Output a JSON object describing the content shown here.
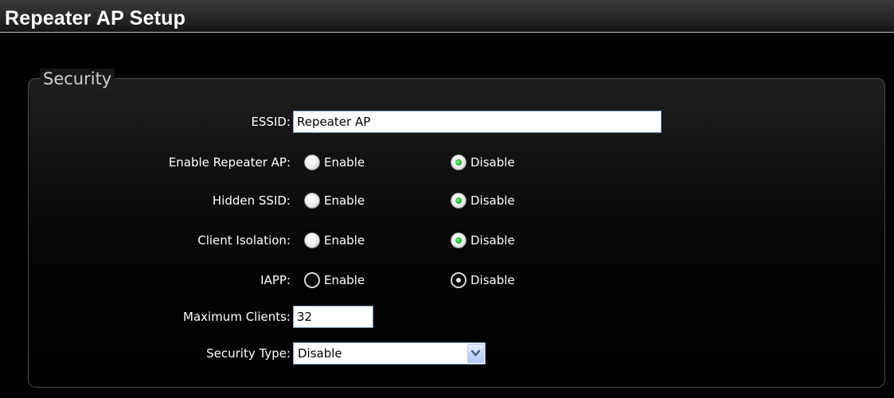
{
  "page": {
    "title": "Repeater AP Setup"
  },
  "security": {
    "legend": "Security",
    "essid": {
      "label": "ESSID:",
      "value": "Repeater AP"
    },
    "enable_repeater_ap": {
      "label": "Enable Repeater AP:",
      "options": [
        "Enable",
        "Disable"
      ],
      "selected": "Disable"
    },
    "hidden_ssid": {
      "label": "Hidden SSID:",
      "options": [
        "Enable",
        "Disable"
      ],
      "selected": "Disable"
    },
    "client_isolation": {
      "label": "Client Isolation:",
      "options": [
        "Enable",
        "Disable"
      ],
      "selected": "Disable"
    },
    "iapp": {
      "label": "IAPP:",
      "options": [
        "Enable",
        "Disable"
      ],
      "selected": "Disable"
    },
    "maximum_clients": {
      "label": "Maximum Clients:",
      "value": "32"
    },
    "security_type": {
      "label": "Security Type:",
      "value": "Disable"
    }
  },
  "icons": {
    "dropdown": "chevron-down-icon"
  },
  "colors": {
    "background": "#000000",
    "text": "#ffffff",
    "radio_selected": "#22b33a",
    "input_border": "#7f9db9"
  }
}
